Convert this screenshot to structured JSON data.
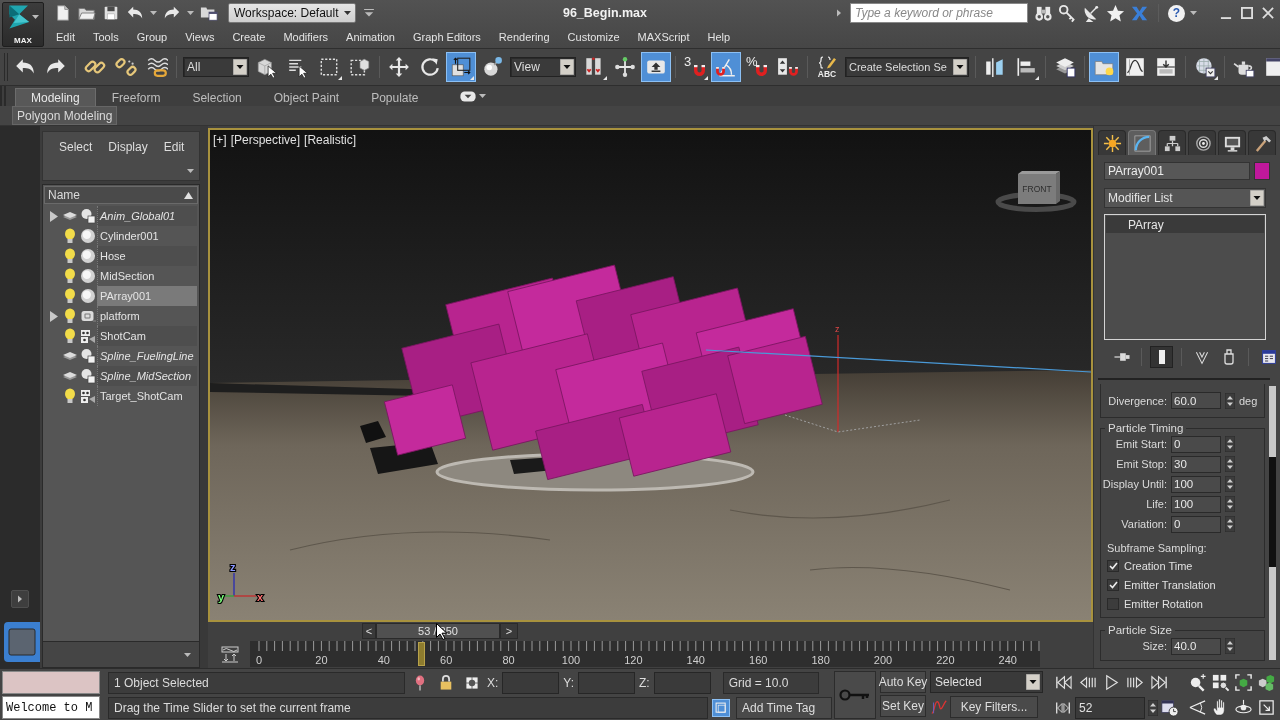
{
  "title_bar": {
    "app_label": "MAX",
    "quick_access": [
      {
        "kind": "new",
        "dropdown": false
      },
      {
        "kind": "open",
        "dropdown": false
      },
      {
        "kind": "save",
        "dropdown": false
      },
      {
        "kind": "undo",
        "dropdown": true
      },
      {
        "kind": "redo",
        "dropdown": true
      },
      {
        "kind": "project",
        "dropdown": false
      }
    ],
    "workspace": "Workspace: Default",
    "title": "96_Begin.max",
    "search": {
      "placeholder": "Type a keyword or phrase"
    },
    "tools": [
      {
        "kind": "binoculars"
      },
      {
        "kind": "key"
      },
      {
        "kind": "satellite"
      },
      {
        "kind": "star"
      },
      {
        "kind": "exchange"
      }
    ],
    "help_label": "?",
    "window_controls": [
      {
        "kind": "minimize"
      },
      {
        "kind": "maximize"
      },
      {
        "kind": "close"
      }
    ]
  },
  "menu_bar": [
    "Edit",
    "Tools",
    "Group",
    "Views",
    "Create",
    "Modifiers",
    "Animation",
    "Graph Editors",
    "Rendering",
    "Customize",
    "MAXScript",
    "Help"
  ],
  "main_toolbar": [
    {
      "kind": "undo",
      "on": false,
      "flyout": false
    },
    {
      "kind": "redo",
      "on": false,
      "flyout": false
    },
    {
      "kind": "separator"
    },
    {
      "kind": "link",
      "on": false,
      "flyout": false
    },
    {
      "kind": "unlink",
      "on": false,
      "flyout": false
    },
    {
      "kind": "bind",
      "on": false,
      "flyout": false
    },
    {
      "kind": "separator"
    },
    {
      "kind": "selection-filter",
      "value": "All"
    },
    {
      "kind": "select",
      "on": false,
      "flyout": false
    },
    {
      "kind": "select-by-name",
      "on": false,
      "flyout": false
    },
    {
      "kind": "region",
      "on": false,
      "flyout": true
    },
    {
      "kind": "window-crossing",
      "on": false,
      "flyout": false
    },
    {
      "kind": "separator"
    },
    {
      "kind": "move",
      "on": false,
      "flyout": false
    },
    {
      "kind": "rotate",
      "on": false,
      "flyout": false
    },
    {
      "kind": "scale",
      "on": true,
      "flyout": true
    },
    {
      "kind": "place",
      "on": false,
      "flyout": false
    },
    {
      "kind": "reference-coordinates",
      "value": "View"
    },
    {
      "kind": "pivot",
      "on": false,
      "flyout": true
    },
    {
      "kind": "manipulate",
      "on": false,
      "flyout": false
    },
    {
      "kind": "shortcut-override",
      "on": true,
      "flyout": false
    },
    {
      "kind": "separator"
    },
    {
      "kind": "snap",
      "label": "3",
      "on": false,
      "flyout": true
    },
    {
      "kind": "angle-snap",
      "on": true,
      "flyout": false
    },
    {
      "kind": "percent-snap",
      "label": "%",
      "on": false,
      "flyout": false
    },
    {
      "kind": "spinner-snap",
      "on": false,
      "flyout": false
    },
    {
      "kind": "separator"
    },
    {
      "kind": "named-sets",
      "label": "ABC",
      "on": false,
      "flyout": false
    },
    {
      "kind": "named-selection",
      "value": "Create Selection Se"
    },
    {
      "kind": "separator"
    },
    {
      "kind": "mirror",
      "on": false,
      "flyout": false
    },
    {
      "kind": "align",
      "on": false,
      "flyout": true
    },
    {
      "kind": "separator"
    },
    {
      "kind": "layers",
      "on": false,
      "flyout": false
    },
    {
      "kind": "separator"
    },
    {
      "kind": "scene-explorer",
      "on": true,
      "flyout": false
    },
    {
      "kind": "curve-editor",
      "on": false,
      "flyout": false
    },
    {
      "kind": "schematic",
      "on": false,
      "flyout": false
    },
    {
      "kind": "separator"
    },
    {
      "kind": "material-editor",
      "on": false,
      "flyout": true
    },
    {
      "kind": "separator"
    },
    {
      "kind": "render-setup",
      "on": false,
      "flyout": false
    },
    {
      "kind": "render-frame",
      "on": false
    }
  ],
  "ribbon": {
    "tabs": [
      {
        "label": "Modeling",
        "selected": true
      },
      {
        "label": "Freeform",
        "selected": false
      },
      {
        "label": "Selection",
        "selected": false
      },
      {
        "label": "Object Paint",
        "selected": false
      },
      {
        "label": "Populate",
        "selected": false
      }
    ],
    "panel": "Polygon Modeling"
  },
  "scene_explorer": {
    "menus": [
      "Select",
      "Display",
      "Edit"
    ],
    "column": "Name",
    "rows": [
      {
        "name": "Anim_Global01",
        "kind": "mixed",
        "visible": false,
        "has_children": true,
        "selected": false
      },
      {
        "name": "Cylinder001",
        "kind": "geometry",
        "visible": true,
        "has_children": false,
        "selected": false
      },
      {
        "name": "Hose",
        "kind": "geometry",
        "visible": true,
        "has_children": false,
        "selected": false
      },
      {
        "name": "MidSection",
        "kind": "geometry",
        "visible": true,
        "has_children": false,
        "selected": false
      },
      {
        "name": "PArray001",
        "kind": "geometry",
        "visible": true,
        "has_children": false,
        "selected": true
      },
      {
        "name": "platform",
        "kind": "container",
        "visible": true,
        "has_children": true,
        "selected": false
      },
      {
        "name": "ShotCam",
        "kind": "camera",
        "visible": true,
        "has_children": false,
        "selected": false
      },
      {
        "name": "Spline_FuelingLine",
        "kind": "mixed",
        "visible": false,
        "has_children": false,
        "selected": false
      },
      {
        "name": "Spline_MidSection",
        "kind": "mixed",
        "visible": false,
        "has_children": false,
        "selected": false
      },
      {
        "name": "Target_ShotCam",
        "kind": "camera",
        "visible": true,
        "has_children": false,
        "selected": false
      }
    ]
  },
  "viewport": {
    "active": true,
    "labels": [
      "[+]",
      "[Perspective]",
      "[Realistic]"
    ],
    "view_cube_face": "FRONT",
    "gizmo_axis": "z",
    "tripod_axes": [
      "z",
      "y",
      "x"
    ]
  },
  "time_slider": {
    "prev": "<",
    "position": "53 / 250",
    "next": ">"
  },
  "track_bar": {
    "labels": [
      "0",
      "20",
      "40",
      "60",
      "80",
      "100",
      "120",
      "140",
      "160",
      "180",
      "200",
      "220",
      "240"
    ],
    "marker": {
      "level": 0.208
    }
  },
  "command_panel": {
    "tabs": [
      {
        "kind": "create",
        "selected": false
      },
      {
        "kind": "modify",
        "selected": true
      },
      {
        "kind": "hierarchy",
        "selected": false
      },
      {
        "kind": "motion",
        "selected": false
      },
      {
        "kind": "display",
        "selected": false
      },
      {
        "kind": "utilities",
        "selected": false
      }
    ],
    "object": {
      "name": "PArray001",
      "color": "#c0189c"
    },
    "modifier_list": "Modifier List",
    "stack": [
      {
        "label": "PArray",
        "selected": true
      }
    ],
    "stack_tools": [
      {
        "kind": "pin",
        "on": false
      },
      {
        "kind": "end-result",
        "on": true
      },
      {
        "kind": "make-unique",
        "on": false
      },
      {
        "kind": "remove",
        "on": false
      },
      {
        "kind": "configure",
        "on": false
      }
    ],
    "divergence": {
      "label": "Divergence:",
      "value": "60.0",
      "unit": "deg"
    },
    "groups": [
      {
        "title": "Particle Timing",
        "spinners": [
          {
            "label": "Emit Start:",
            "value": "0"
          },
          {
            "label": "Emit Stop:",
            "value": "30"
          },
          {
            "label": "Display Until:",
            "value": "100"
          },
          {
            "label": "Life:",
            "value": "100"
          },
          {
            "label": "Variation:",
            "value": "0"
          }
        ],
        "subtitle": "Subframe Sampling:",
        "checkboxes": [
          {
            "label": "Creation Time",
            "checked": true
          },
          {
            "label": "Emitter Translation",
            "checked": true
          },
          {
            "label": "Emitter Rotation",
            "checked": false
          }
        ]
      },
      {
        "title": "Particle Size",
        "spinners": [
          {
            "label": "Size:",
            "value": "40.0"
          }
        ]
      }
    ]
  },
  "status_bar": {
    "listener_input": "Welcome to M",
    "selection_info": "1 Object Selected",
    "selection_lock": {
      "on": false
    },
    "coordinates": [
      "X:",
      "Y:",
      "Z:"
    ],
    "grid": "Grid = 10.0",
    "prompt": "Drag the Time Slider to set the current frame",
    "degradation": {
      "on": true
    },
    "time_tag": "Add Time Tag",
    "auto_key": {
      "label": "Auto Key",
      "on": false
    },
    "set_key": "Set Key",
    "key_set": "Selected",
    "key_filters": "Key Filters...",
    "playback": [
      {
        "kind": "go-start"
      },
      {
        "kind": "prev-frame"
      },
      {
        "kind": "play"
      },
      {
        "kind": "next-frame"
      },
      {
        "kind": "go-end"
      }
    ],
    "frame": "52",
    "navigation": [
      {
        "kind": "zoom"
      },
      {
        "kind": "zoom-all"
      },
      {
        "kind": "zoom-extents"
      },
      {
        "kind": "zoom-extents-all"
      },
      {
        "kind": "field-of-view"
      },
      {
        "kind": "pan"
      },
      {
        "kind": "orbit"
      },
      {
        "kind": "maximize-viewport"
      }
    ]
  }
}
